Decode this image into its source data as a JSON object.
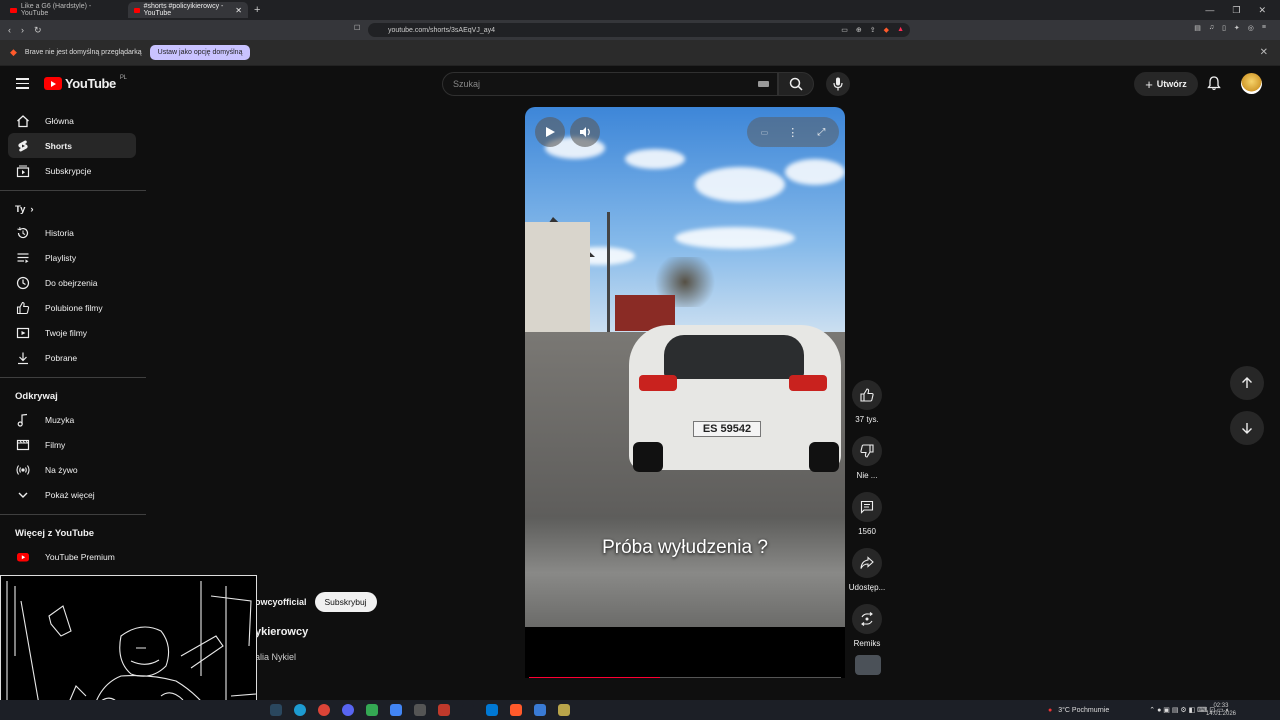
{
  "browser": {
    "tabs": [
      {
        "label": "Like a G6 (Hardstyle) - YouTube"
      },
      {
        "label": "#shorts #policyikierowcy - YouTube"
      }
    ],
    "url": "youtube.com/shorts/3sAEqVJ_ay4",
    "notice_text": "Brave nie jest domyślną przeglądarką",
    "notice_button": "Ustaw jako opcję domyślną"
  },
  "header": {
    "logo_text": "YouTube",
    "logo_region": "PL",
    "search_placeholder": "Szukaj",
    "create_label": "Utwórz"
  },
  "sidebar": {
    "main": [
      {
        "label": "Główna",
        "icon": "home-icon"
      },
      {
        "label": "Shorts",
        "icon": "shorts-icon",
        "active": true
      },
      {
        "label": "Subskrypcje",
        "icon": "subscriptions-icon"
      }
    ],
    "you_label": "Ty",
    "you": [
      {
        "label": "Historia",
        "icon": "history-icon"
      },
      {
        "label": "Playlisty",
        "icon": "playlists-icon"
      },
      {
        "label": "Do obejrzenia",
        "icon": "clock-icon"
      },
      {
        "label": "Polubione filmy",
        "icon": "like-icon"
      },
      {
        "label": "Twoje filmy",
        "icon": "video-icon"
      },
      {
        "label": "Pobrane",
        "icon": "download-icon"
      }
    ],
    "explore_label": "Odkrywaj",
    "explore": [
      {
        "label": "Muzyka",
        "icon": "music-icon"
      },
      {
        "label": "Filmy",
        "icon": "film-icon"
      },
      {
        "label": "Na żywo",
        "icon": "live-icon"
      },
      {
        "label": "Pokaż więcej",
        "icon": "chevron-down-icon"
      }
    ],
    "more_label": "Więcej z YouTube",
    "more": [
      {
        "label": "YouTube Premium",
        "icon": "youtube-premium-icon"
      }
    ]
  },
  "player": {
    "caption": "Próba wyłudzenia ?",
    "plate": "ES 59542",
    "progress": 0.42
  },
  "actions": {
    "likes": "37 tys.",
    "dislike": "Nie ...",
    "comments": "1560",
    "share": "Udostęp...",
    "remix": "Remiks"
  },
  "channel": {
    "name": "owcyofficial",
    "subscribe": "Subskrybuj",
    "title": "ykierowcy",
    "sound": "alia Nykiel"
  },
  "taskbar": {
    "weather": "3°C  Pochmurnie",
    "time": "02:33",
    "date": "14.01.2026"
  },
  "colors": {
    "accent": "#ff0000",
    "progress": "#ff0033",
    "background": "#0f0f0f"
  }
}
